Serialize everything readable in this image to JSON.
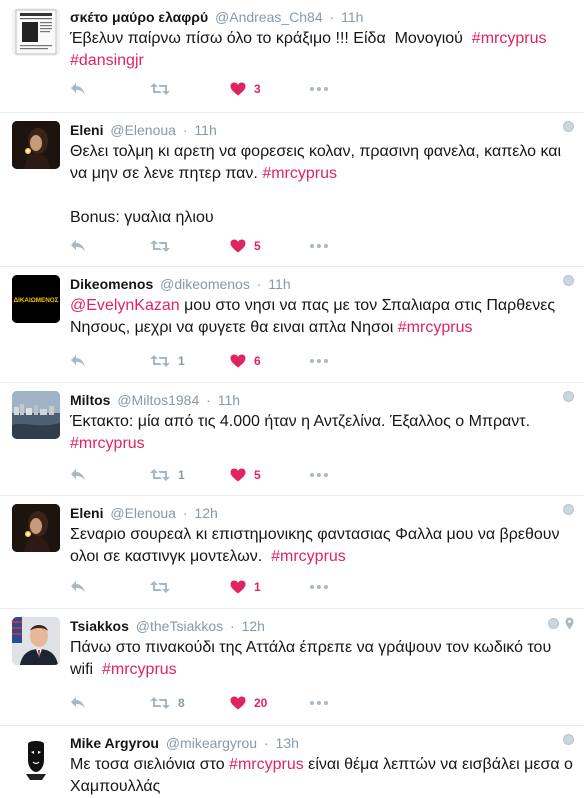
{
  "tweets": [
    {
      "fullname": "σκέτο μαύρο ελαφρύ",
      "username": "@Andreas_Ch84",
      "time": "11h",
      "segments": [
        {
          "t": "Έβελυν παίρνω πίσω όλο το κράξιμο !!! Είδα  Μονογιού  ",
          "k": "text"
        },
        {
          "t": "#mrcyprus",
          "k": "tag"
        },
        {
          "t": "\n",
          "k": "text"
        },
        {
          "t": "#dansingjr",
          "k": "tag"
        }
      ],
      "retweets": "",
      "likes": "3",
      "avatar": "newspaper",
      "corner": "none"
    },
    {
      "fullname": "Eleni",
      "username": "@Elenoua",
      "time": "11h",
      "segments": [
        {
          "t": "Θελει τολμη κι αρετη να φορεσεις κολαν, πρασινη φανελα, καπελο και να μην σε λενε πητερ παν. ",
          "k": "text"
        },
        {
          "t": "#mrcyprus",
          "k": "tag"
        },
        {
          "t": "\n\nBonus: γυαλια ηλιου",
          "k": "text"
        }
      ],
      "retweets": "",
      "likes": "5",
      "avatar": "candle",
      "corner": "globe"
    },
    {
      "fullname": "Dikeomenos",
      "username": "@dikeomenos",
      "time": "11h",
      "segments": [
        {
          "t": "@EvelynKazan",
          "k": "mention"
        },
        {
          "t": " μου στο νησι να πας με τον Σπαλιαρα στις Παρθενες Νησους, μεχρι να φυγετε θα ειναι απλα Νησοι ",
          "k": "text"
        },
        {
          "t": "#mrcyprus",
          "k": "tag"
        }
      ],
      "retweets": "1",
      "likes": "6",
      "avatar": "logo",
      "avatar_text": "ΔΙΚΑΙΩΜΕΝΟΣ",
      "corner": "globe"
    },
    {
      "fullname": "Miltos",
      "username": "@Miltos1984",
      "time": "11h",
      "segments": [
        {
          "t": "Έκτακτο: μία από τις 4.000 ήταν η Αντζελίνα. Έξαλλος ο Μπραντ.\n",
          "k": "text"
        },
        {
          "t": "#mrcyprus",
          "k": "tag"
        }
      ],
      "retweets": "1",
      "likes": "5",
      "avatar": "city",
      "corner": "globe"
    },
    {
      "fullname": "Eleni",
      "username": "@Elenoua",
      "time": "12h",
      "segments": [
        {
          "t": "Σεναριο σουρεαλ κι επιστημονικης φαντασιας Φαλλα μου να βρεθουν ολοι σε καστινγκ μοντελων.  ",
          "k": "text"
        },
        {
          "t": "#mrcyprus",
          "k": "tag"
        }
      ],
      "retweets": "",
      "likes": "1",
      "avatar": "candle",
      "corner": "globe"
    },
    {
      "fullname": "Tsiakkos",
      "username": "@theTsiakkos",
      "time": "12h",
      "segments": [
        {
          "t": "Πάνω στο πινακούδι της Αττάλα έπρεπε να γράψουν τον κωδικό του wifi  ",
          "k": "text"
        },
        {
          "t": "#mrcyprus",
          "k": "tag"
        }
      ],
      "retweets": "8",
      "likes": "20",
      "avatar": "portrait",
      "corner": "globe-pin"
    },
    {
      "fullname": "Mike Argyrou",
      "username": "@mikeargyrou",
      "time": "13h",
      "segments": [
        {
          "t": "Με τοσα σιελιόνια στο ",
          "k": "text"
        },
        {
          "t": "#mrcyprus",
          "k": "tag"
        },
        {
          "t": " είναι θέμα λεπτών να εισβάλει μεσα ο Χαμπουλλάς",
          "k": "text"
        }
      ],
      "retweets": "",
      "likes": "",
      "avatar": "mask",
      "corner": "globe"
    }
  ]
}
